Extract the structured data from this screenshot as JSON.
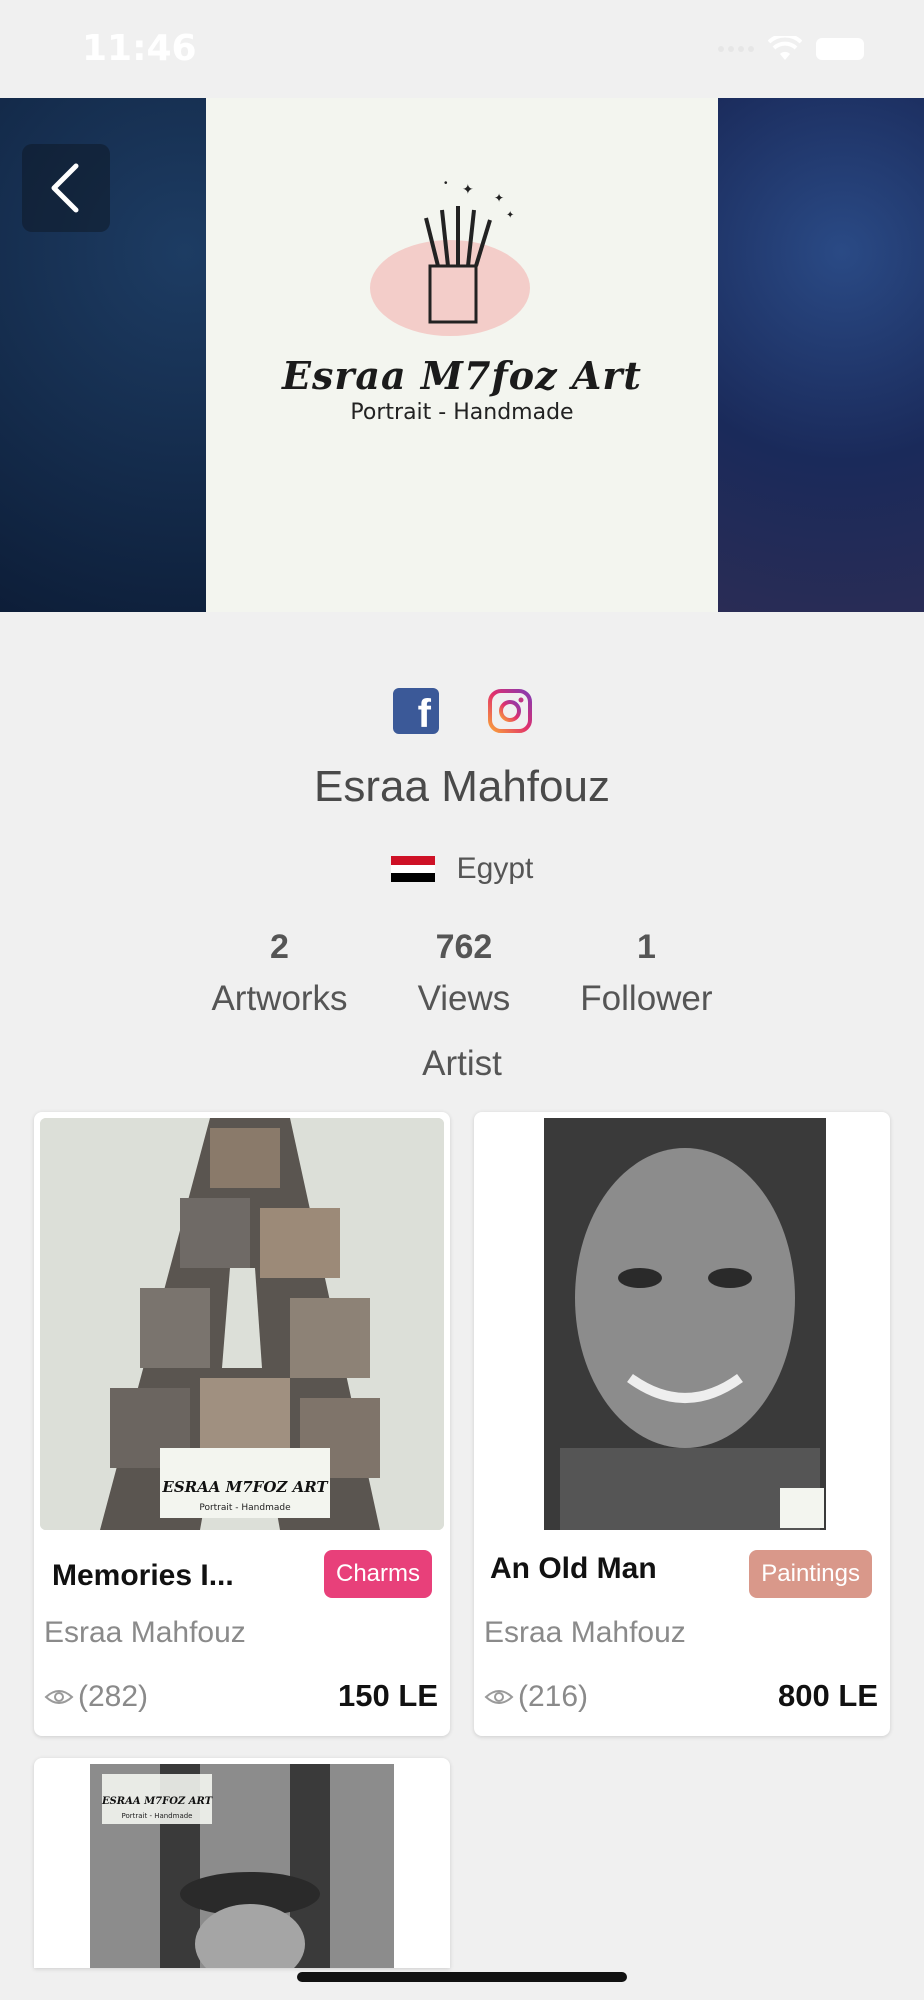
{
  "status": {
    "time": "11:46"
  },
  "banner": {
    "logo_title": "Esraa M7foz Art",
    "logo_subtitle": "Portrait - Handmade"
  },
  "artist": {
    "name": "Esraa Mahfouz",
    "country": "Egypt",
    "role": "Artist",
    "stats": [
      {
        "value": "2",
        "label": "Artworks"
      },
      {
        "value": "762",
        "label": "Views"
      },
      {
        "value": "1",
        "label": "Follower"
      }
    ]
  },
  "artworks": [
    {
      "title": "Memories I...",
      "category": "Charms",
      "category_color": "#e8407a",
      "artist": "Esraa Mahfouz",
      "views": "(282)",
      "price": "150 LE"
    },
    {
      "title": "An Old Man",
      "category": "Paintings",
      "category_color": "#d9988a",
      "artist": "Esraa Mahfouz",
      "views": "(216)",
      "price": "800 LE"
    }
  ],
  "colors": {
    "facebook": "#3b5998",
    "background": "#f0f0f0"
  }
}
